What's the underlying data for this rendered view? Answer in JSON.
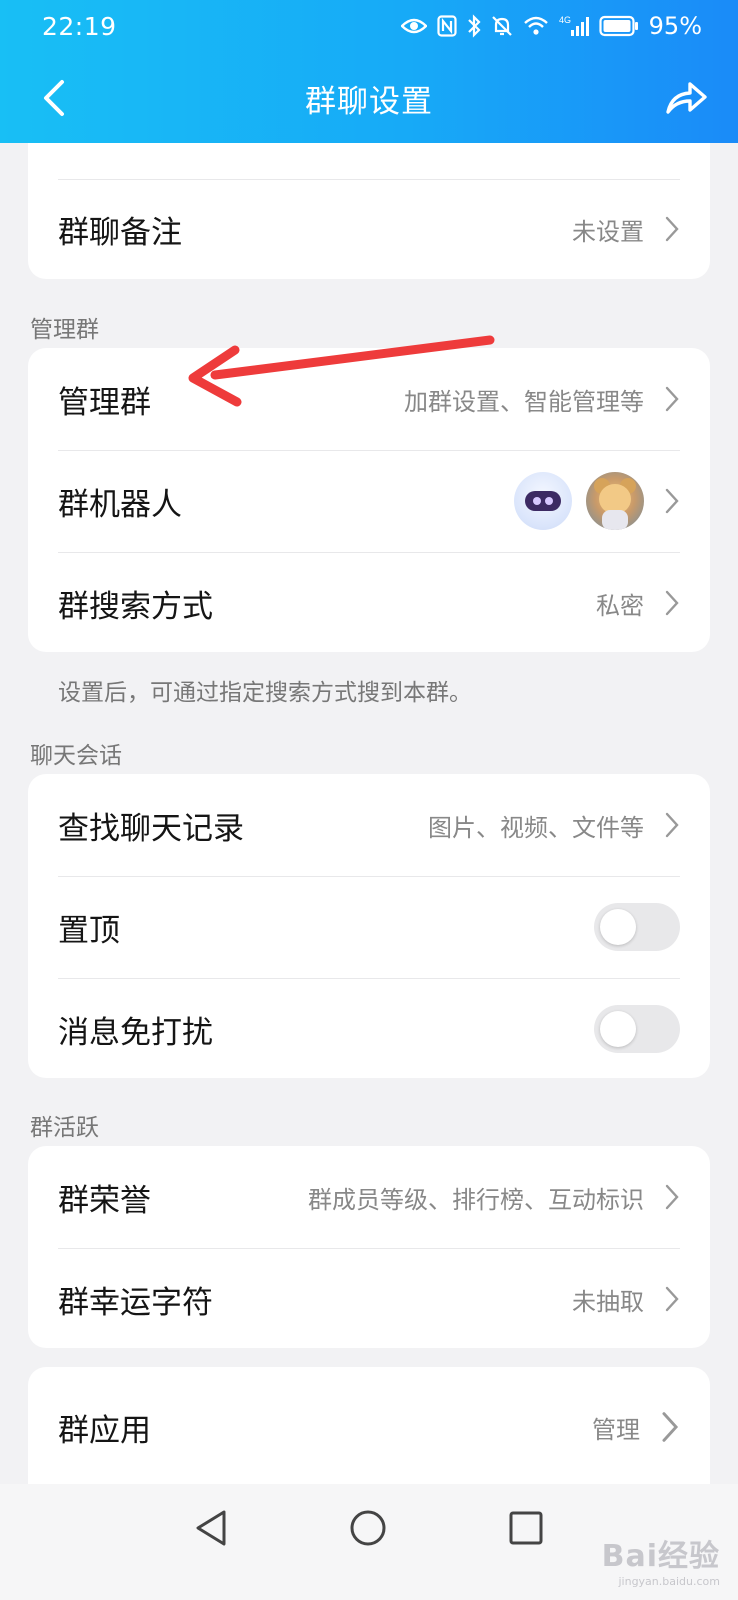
{
  "status_bar": {
    "time": "22:19",
    "network": "4G",
    "battery": "95%"
  },
  "header": {
    "title": "群聊设置"
  },
  "group_remark": {
    "label": "群聊备注",
    "value": "未设置"
  },
  "manage_section": {
    "title": "管理群",
    "items": [
      {
        "label": "管理群",
        "value": "加群设置、智能管理等"
      },
      {
        "label": "群机器人",
        "value": ""
      },
      {
        "label": "群搜索方式",
        "value": "私密"
      }
    ],
    "hint": "设置后，可通过指定搜索方式搜到本群。"
  },
  "chat_section": {
    "title": "聊天会话",
    "items": [
      {
        "label": "查找聊天记录",
        "value": "图片、视频、文件等"
      },
      {
        "label": "置顶",
        "toggle": false
      },
      {
        "label": "消息免打扰",
        "toggle": false
      }
    ]
  },
  "activity_section": {
    "title": "群活跃",
    "items": [
      {
        "label": "群荣誉",
        "value": "群成员等级、排行榜、互动标识"
      },
      {
        "label": "群幸运字符",
        "value": "未抽取"
      }
    ]
  },
  "apps": {
    "label": "群应用",
    "value": "管理"
  },
  "watermark": {
    "brand": "Bai经验",
    "url": "jingyan.baidu.com"
  },
  "colors": {
    "header_start": "#18bff5",
    "header_end": "#1a8bf8",
    "annotation_arrow": "#ee3b3b"
  }
}
